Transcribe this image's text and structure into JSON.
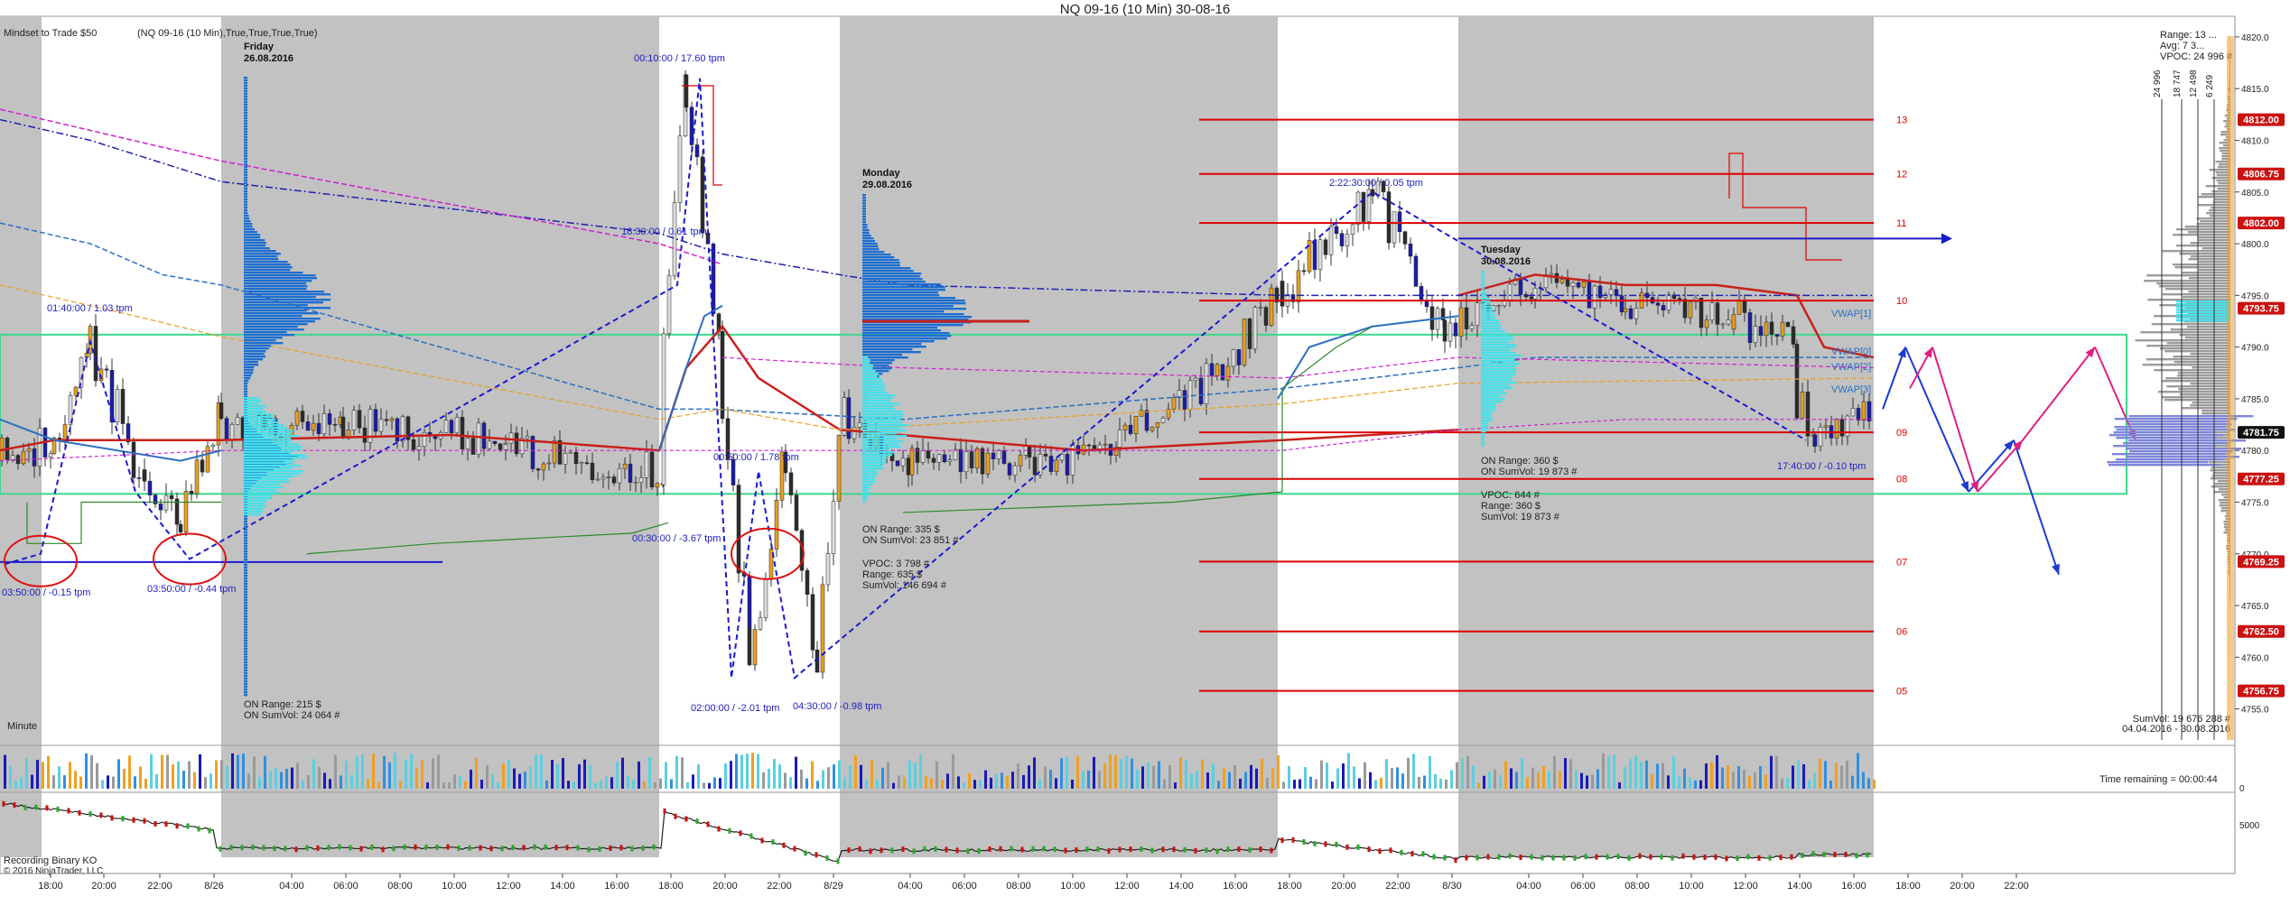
{
  "window": {
    "title": "NQ 09-16 (10 Min)  30-08-16",
    "indicator_label": "Mindset to Trade  $50",
    "series_label": "(NQ 09-16 (10 Min),True,True,True,True)",
    "timeframe_label": "Minute",
    "footer_line1": "Recording Binary KO",
    "footer_line2": "© 2016 NinjaTrader, LLC",
    "time_remaining": "Time remaining = 00:00:44"
  },
  "colors": {
    "session_shade": "#c2c2c2",
    "level_line": "#dd0000",
    "profile_blue": "#1e6fd0",
    "profile_cyan": "#48e0e8",
    "box_green": "#3dd68c",
    "zigzag_blue": "#1a1ad0",
    "vwap_red": "#c8201a",
    "vwap_blue": "#2a6fc0",
    "arrow_pink": "#e0207f"
  },
  "chart_data": {
    "type": "candlestick",
    "instrument": "NQ 09-16",
    "interval": "10 Min",
    "ylim": [
      4752,
      4822
    ],
    "y_ticks": [
      4755,
      4760,
      4765,
      4770,
      4775,
      4780,
      4785,
      4790,
      4795,
      4800,
      4805,
      4810,
      4815,
      4820
    ],
    "x_ticks": [
      "18:00",
      "18:00",
      "20:00",
      "22:00",
      "8/26",
      "04:00",
      "06:00",
      "08:00",
      "10:00",
      "12:00",
      "14:00",
      "16:00",
      "18:00",
      "20:00",
      "22:00",
      "8/29",
      "04:00",
      "06:00",
      "08:00",
      "10:00",
      "12:00",
      "14:00",
      "16:00",
      "18:00",
      "20:00",
      "22:00",
      "8/30",
      "04:00",
      "06:00",
      "08:00",
      "10:00",
      "12:00",
      "14:00",
      "16:00",
      "18:00",
      "20:00",
      "22:00"
    ],
    "price_badges": [
      {
        "value": "4812.00",
        "color": "#cc1111"
      },
      {
        "value": "4806.75",
        "color": "#cc1111"
      },
      {
        "value": "4802.00",
        "color": "#cc1111"
      },
      {
        "value": "4793.75",
        "color": "#cc1111"
      },
      {
        "value": "4781.75",
        "color": "#111111"
      },
      {
        "value": "4777.25",
        "color": "#cc1111"
      },
      {
        "value": "4769.25",
        "color": "#cc1111"
      },
      {
        "value": "4762.50",
        "color": "#cc1111"
      },
      {
        "value": "4756.75",
        "color": "#cc1111"
      }
    ],
    "levels": [
      {
        "label": "13",
        "price": 4812.0
      },
      {
        "label": "12",
        "price": 4806.75
      },
      {
        "label": "11",
        "price": 4802.0
      },
      {
        "label": "10",
        "price": 4794.5
      },
      {
        "label": "09",
        "price": 4781.75
      },
      {
        "label": "08",
        "price": 4777.25
      },
      {
        "label": "07",
        "price": 4769.25
      },
      {
        "label": "06",
        "price": 4762.5
      },
      {
        "label": "05",
        "price": 4756.75
      }
    ],
    "sessions": [
      {
        "label_day": "Friday",
        "label_date": "26.08.2016"
      },
      {
        "label_day": "Monday",
        "label_date": "29.08.2016"
      },
      {
        "label_day": "Tuesday",
        "label_date": "30.08.2016"
      }
    ],
    "annotations": [
      "01:40:00 / 1.03 tpm",
      "03:50:00 / -0.15 tpm",
      "03:50:00 / -0.44 tpm",
      "00:10:00 / 17.60 tpm",
      "18:30:00 / 0.61 tpm",
      "00:30:00 / -3.67 tpm",
      "02:00:00 / -2.01 tpm",
      "00:50:00 / 1.78 tpm",
      "04:30:00 / -0.98 tpm",
      "2:22:30:00 / 0.05 tpm",
      "17:40:00 / -0.10 tpm"
    ],
    "vwap_labels": [
      "VWAP[1]",
      "VWAP[0]",
      "VWAP[2]",
      "VWAP[3]"
    ],
    "profile_stats": {
      "friday": {
        "on_range": "ON Range:   215 $",
        "on_sumvol": "ON SumVol:  24 064 #"
      },
      "monday": {
        "on_range": "ON Range:   335 $",
        "on_sumvol": "ON SumVol:  23 851 #",
        "vpoc": "VPOC:     3 798 #",
        "range": "Range:     635 $",
        "sumvol": "SumVol:   146 694 #"
      },
      "tuesday": {
        "on_range": "ON Range:   360 $",
        "on_sumvol": "ON SumVol:  19 873 #",
        "vpoc": "VPOC:     644 #",
        "range": "Range:     360 $",
        "sumvol": "SumVol:   19 873 #"
      }
    },
    "right_panel": {
      "range": "Range:  13 ...",
      "avg": "Avg:    7 3...",
      "vpoc": "VPOC:   24 996 #",
      "scale_labels": [
        "24 996",
        "18 747",
        "12 498",
        "6 249"
      ],
      "sumvol": "SumVol: 19 676 288 #",
      "dates": "04.04.2016 - 30.08.2016"
    },
    "volume_panel": {
      "y_ticks": [
        "0"
      ]
    },
    "lower_panel": {
      "y_ticks": [
        "5000"
      ]
    }
  }
}
